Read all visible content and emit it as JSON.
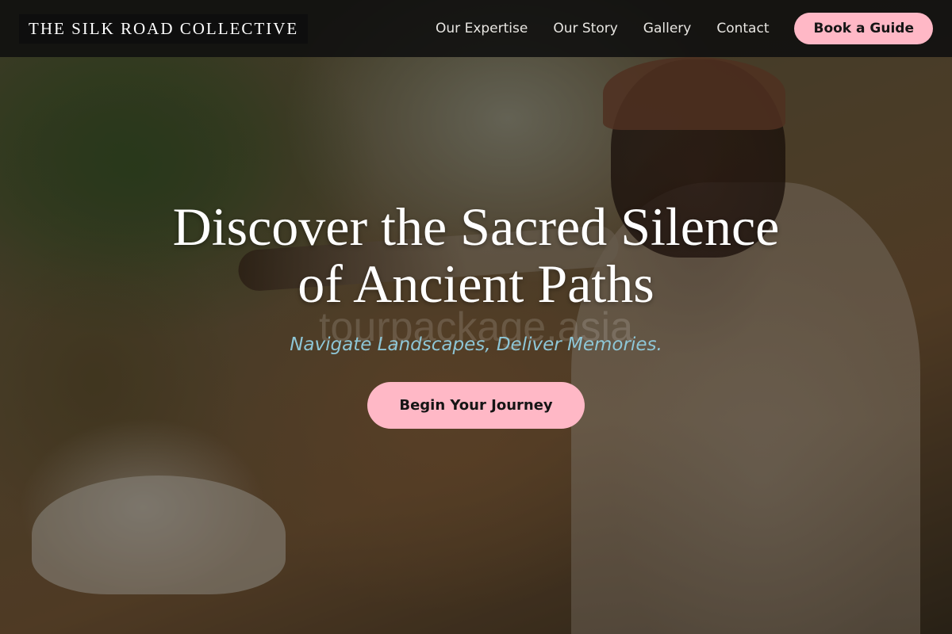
{
  "nav": {
    "brand": "THE SILK ROAD COLLECTIVE",
    "links": [
      "Our Expertise",
      "Our Story",
      "Gallery",
      "Contact"
    ],
    "cta": "Book a Guide"
  },
  "hero": {
    "title_line1": "Discover the Sacred Silence",
    "title_line2": "of Ancient Paths",
    "watermark": "tourpackage.asia",
    "subtitle": "Navigate Landscapes, Deliver Memories.",
    "cta": "Begin Your Journey"
  },
  "colors": {
    "accent": "#ffb8c6",
    "subtitle": "#8ec6d6",
    "nav_bg": "#0f0f0f"
  }
}
